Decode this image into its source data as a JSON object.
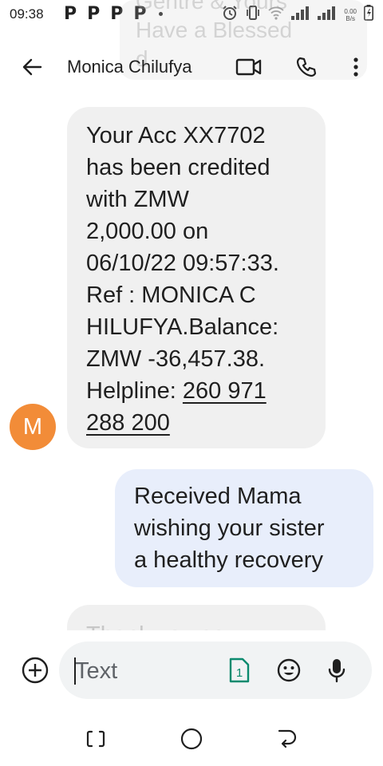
{
  "status_bar": {
    "time": "09:38",
    "notification_icons": [
      "P",
      "P",
      "P",
      "P"
    ],
    "net_speed_value": "0.00",
    "net_speed_unit": "B/s"
  },
  "ghost_notification": {
    "lines": [
      "Gentre & Yours",
      "Have a Blessed",
      "d"
    ]
  },
  "app_bar": {
    "contact_name": "Monica Chilufya"
  },
  "messages": {
    "incoming": {
      "lines": [
        "Your Acc XX7702",
        "has been credited",
        "with ZMW",
        "2,000.00 on",
        "06/10/22 09:57:33.",
        "Ref : MONICA C",
        "HILUFYA.Balance:",
        "ZMW -36,457.38.",
        "Helpline: "
      ],
      "phone_part1": "260 971",
      "phone_part2": "288 200",
      "avatar_letter": "M"
    },
    "outgoing": {
      "lines": [
        "Received Mama",
        "wishing your sister",
        "a healthy recovery"
      ]
    },
    "partial": {
      "text": "Thank you so"
    }
  },
  "compose": {
    "placeholder": "Text",
    "sim_label": "1"
  },
  "colors": {
    "avatar_bg": "#f28c38",
    "incoming_bubble": "#f0f0f0",
    "outgoing_bubble": "#e8eefb",
    "sim_icon": "#0b8a6e"
  }
}
